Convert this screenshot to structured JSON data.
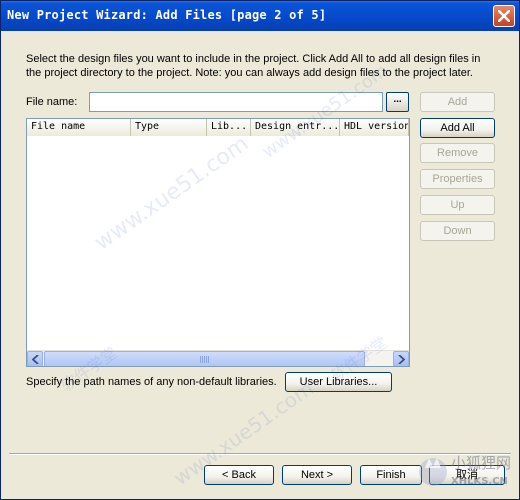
{
  "window": {
    "title": "New Project Wizard: Add Files [page 2 of 5]",
    "instructions": "Select the design files you want to include in the project. Click Add All to add all design files in the project directory to the project. Note: you can always add design files to the project later."
  },
  "file_name": {
    "label": "File name:",
    "value": "",
    "browse_label": "..."
  },
  "table": {
    "columns": [
      "File name",
      "Type",
      "Lib...",
      "Design entr...",
      "HDL version"
    ],
    "rows": []
  },
  "side_buttons": {
    "add": "Add",
    "add_all": "Add All",
    "remove": "Remove",
    "properties": "Properties",
    "up": "Up",
    "down": "Down"
  },
  "libraries": {
    "text": "Specify the path names of any non-default libraries.",
    "button": "User Libraries..."
  },
  "footer": {
    "back": "< Back",
    "next": "Next >",
    "finish": "Finish",
    "cancel": "取消"
  },
  "watermark": {
    "site": "www.xue51.com",
    "cn_text": "软件学堂",
    "logo_text": "小狐狸网",
    "logo_domain": "XHLKS.CN"
  },
  "colors": {
    "titlebar": "#0548c8",
    "dialog": "#ece9d8",
    "close_button": "#c4411e",
    "border": "#003c74"
  }
}
